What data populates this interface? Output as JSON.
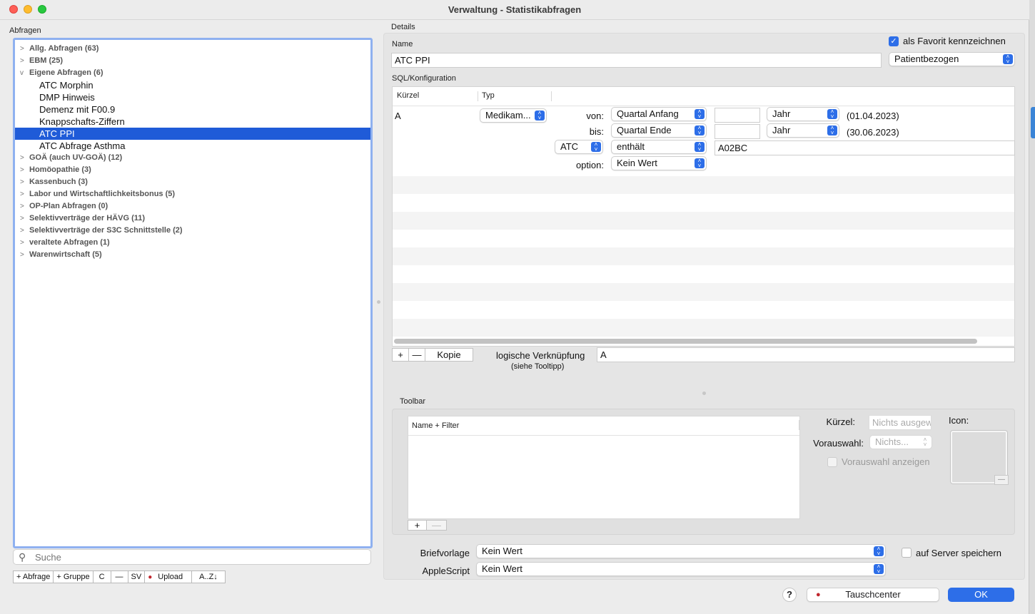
{
  "window": {
    "title": "Verwaltung - Statistikabfragen"
  },
  "left": {
    "section_label": "Abfragen",
    "tree": {
      "group_allg": "Allg. Abfragen (63)",
      "group_ebm": "EBM (25)",
      "group_eigene": "Eigene Abfragen (6)",
      "child_1": "ATC Morphin",
      "child_2": "DMP Hinweis",
      "child_3": "Demenz mit F00.9",
      "child_4": "Knappschafts-Ziffern",
      "child_5": "ATC PPI",
      "child_6": "ATC Abfrage Asthma",
      "group_goa": "GOÄ (auch UV-GOÄ) (12)",
      "group_homo": "Homöopathie (3)",
      "group_kasse": "Kassenbuch (3)",
      "group_labor": "Labor und Wirtschaftlichkeitsbonus (5)",
      "group_op": "OP-Plan Abfragen (0)",
      "group_havg": "Selektivverträge der HÄVG (11)",
      "group_s3c": "Selektivverträge der S3C Schnittstelle (2)",
      "group_veraltet": "veraltete Abfragen (1)",
      "group_waren": "Warenwirtschaft (5)",
      "selected": "ATC PPI"
    },
    "search_placeholder": "Suche",
    "buttons": {
      "add_query": "+ Abfrage",
      "add_group": "+ Gruppe",
      "copy": "C",
      "remove": "—",
      "save": "SV",
      "upload": "Upload",
      "sort": "A..Z↓"
    }
  },
  "details": {
    "section_label": "Details",
    "favorite_label": "als Favorit kennzeichnen",
    "favorite_checked": true,
    "name_label": "Name",
    "name_value": "ATC PPI",
    "scope_value": "Patientbezogen",
    "sql_label": "SQL/Konfiguration",
    "columns": {
      "kuerzel": "Kürzel",
      "typ": "Typ"
    },
    "row": {
      "kuerzel": "A",
      "typ": "Medikam...",
      "von_label": "von:",
      "von_value": "Quartal Anfang",
      "von_unit": "Jahr",
      "von_date": "(01.04.2023)",
      "bis_label": "bis:",
      "bis_value": "Quartal Ende",
      "bis_unit": "Jahr",
      "bis_date": "(30.06.2023)",
      "field_value": "ATC",
      "operator_value": "enthält",
      "match_value": "A02BC",
      "option_label": "option:",
      "option_value": "Kein Wert"
    },
    "add_label": "+",
    "remove_label": "—",
    "copy_label": "Kopie",
    "logic_label": "logische Verknüpfung",
    "logic_hint": "(siehe Tooltipp)",
    "logic_value": "A"
  },
  "toolbar": {
    "section_label": "Toolbar",
    "column_name": "Name + Filter",
    "kuerzel_label": "Kürzel:",
    "kuerzel_placeholder": "Nichts ausgew",
    "vorauswahl_label": "Vorauswahl:",
    "vorauswahl_value": "Nichts...",
    "vorauswahl_anzeigen_label": "Vorauswahl anzeigen",
    "icon_label": "Icon:",
    "add_label": "+",
    "remove_label": "—"
  },
  "bottom": {
    "briefvorlage_label": "Briefvorlage",
    "briefvorlage_value": "Kein Wert",
    "applescript_label": "AppleScript",
    "applescript_value": "Kein Wert",
    "server_label": "auf Server speichern",
    "help_label": "?",
    "tauschcenter_label": "Tauschcenter",
    "ok_label": "OK"
  },
  "colors": {
    "accent": "#2d6ee8",
    "selection": "#1f5bd8",
    "focus_ring": "#8fb1f0"
  }
}
